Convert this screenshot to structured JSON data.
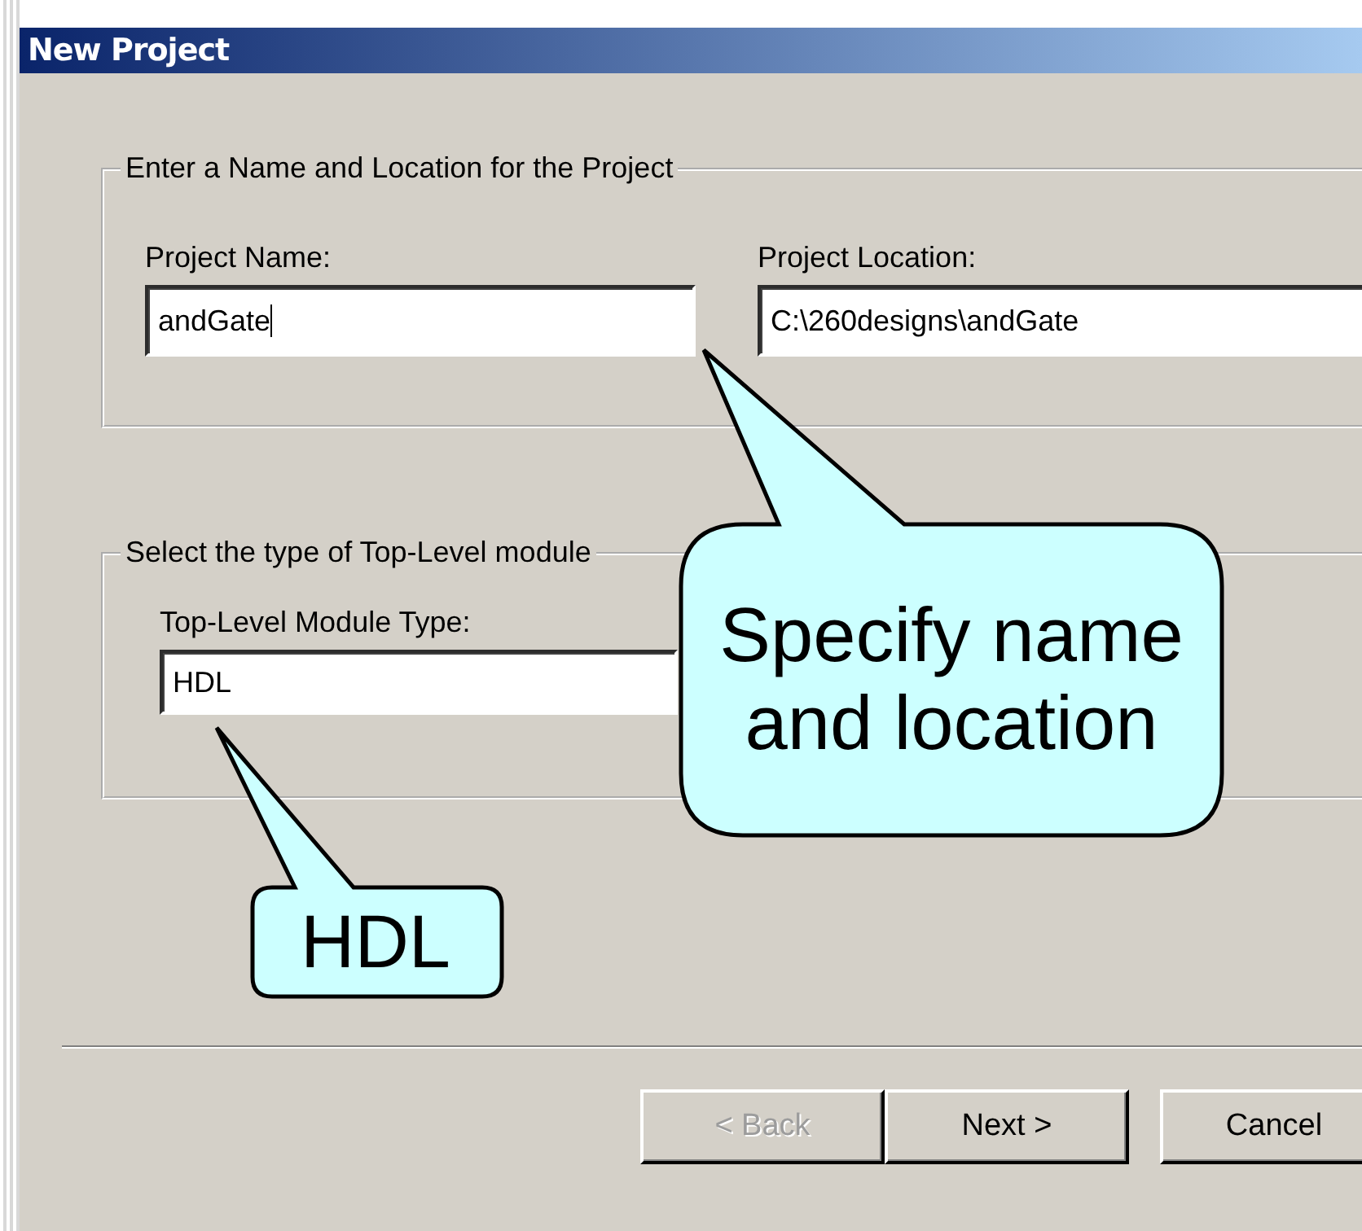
{
  "window": {
    "title": "New Project"
  },
  "name_location_group": {
    "title": "Enter a Name and Location for the Project",
    "fields": [
      {
        "label": "Project Name:",
        "value": "andGate",
        "focused": true
      },
      {
        "label": "Project Location:",
        "value": "C:\\260designs\\andGate",
        "focused": false
      }
    ]
  },
  "module_group": {
    "title": "Select the type of Top-Level module",
    "label": "Top-Level Module Type:",
    "value": "HDL"
  },
  "buttons": [
    {
      "label": "< Back",
      "disabled": true
    },
    {
      "label": "Next >",
      "disabled": false
    },
    {
      "label": "Cancel",
      "disabled": false
    }
  ],
  "callouts": [
    {
      "text": "Specify name and location"
    },
    {
      "text": "HDL"
    }
  ]
}
